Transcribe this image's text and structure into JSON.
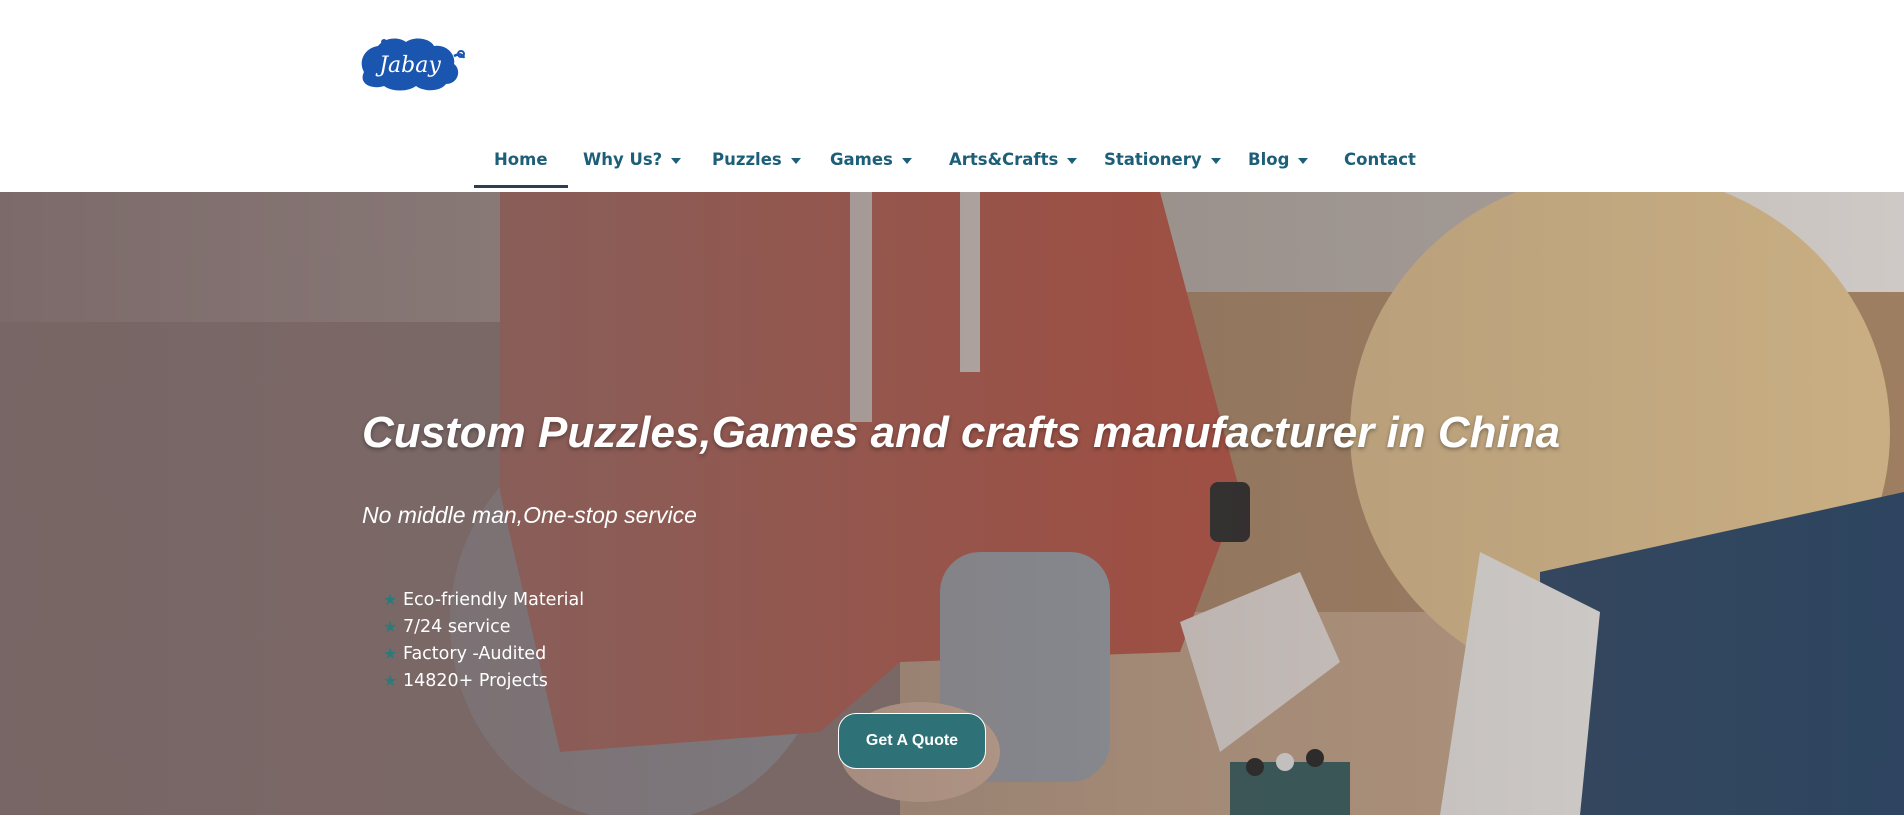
{
  "header": {
    "logo_text": "Jabay",
    "logo_color": "#1a56b0"
  },
  "nav": {
    "items": [
      {
        "label": "Home",
        "active": true,
        "has_dropdown": false
      },
      {
        "label": "Why Us?",
        "active": false,
        "has_dropdown": true
      },
      {
        "label": "Puzzles",
        "active": false,
        "has_dropdown": true
      },
      {
        "label": "Games",
        "active": false,
        "has_dropdown": true
      },
      {
        "label": "Arts&Crafts",
        "active": false,
        "has_dropdown": true
      },
      {
        "label": "Stationery",
        "active": false,
        "has_dropdown": true
      },
      {
        "label": "Blog",
        "active": false,
        "has_dropdown": true
      },
      {
        "label": "Contact",
        "active": false,
        "has_dropdown": false
      }
    ],
    "color": "#1d5f78"
  },
  "hero": {
    "title": "Custom Puzzles,Games and crafts manufacturer in China",
    "subtitle": "No middle man,One-stop service",
    "features": [
      "Eco-friendly Material",
      "7/24 service",
      "Factory -Audited",
      "14820+ Projects"
    ],
    "feature_icon": "star-icon",
    "cta_label": "Get A Quote",
    "accent": "#2e7176"
  }
}
